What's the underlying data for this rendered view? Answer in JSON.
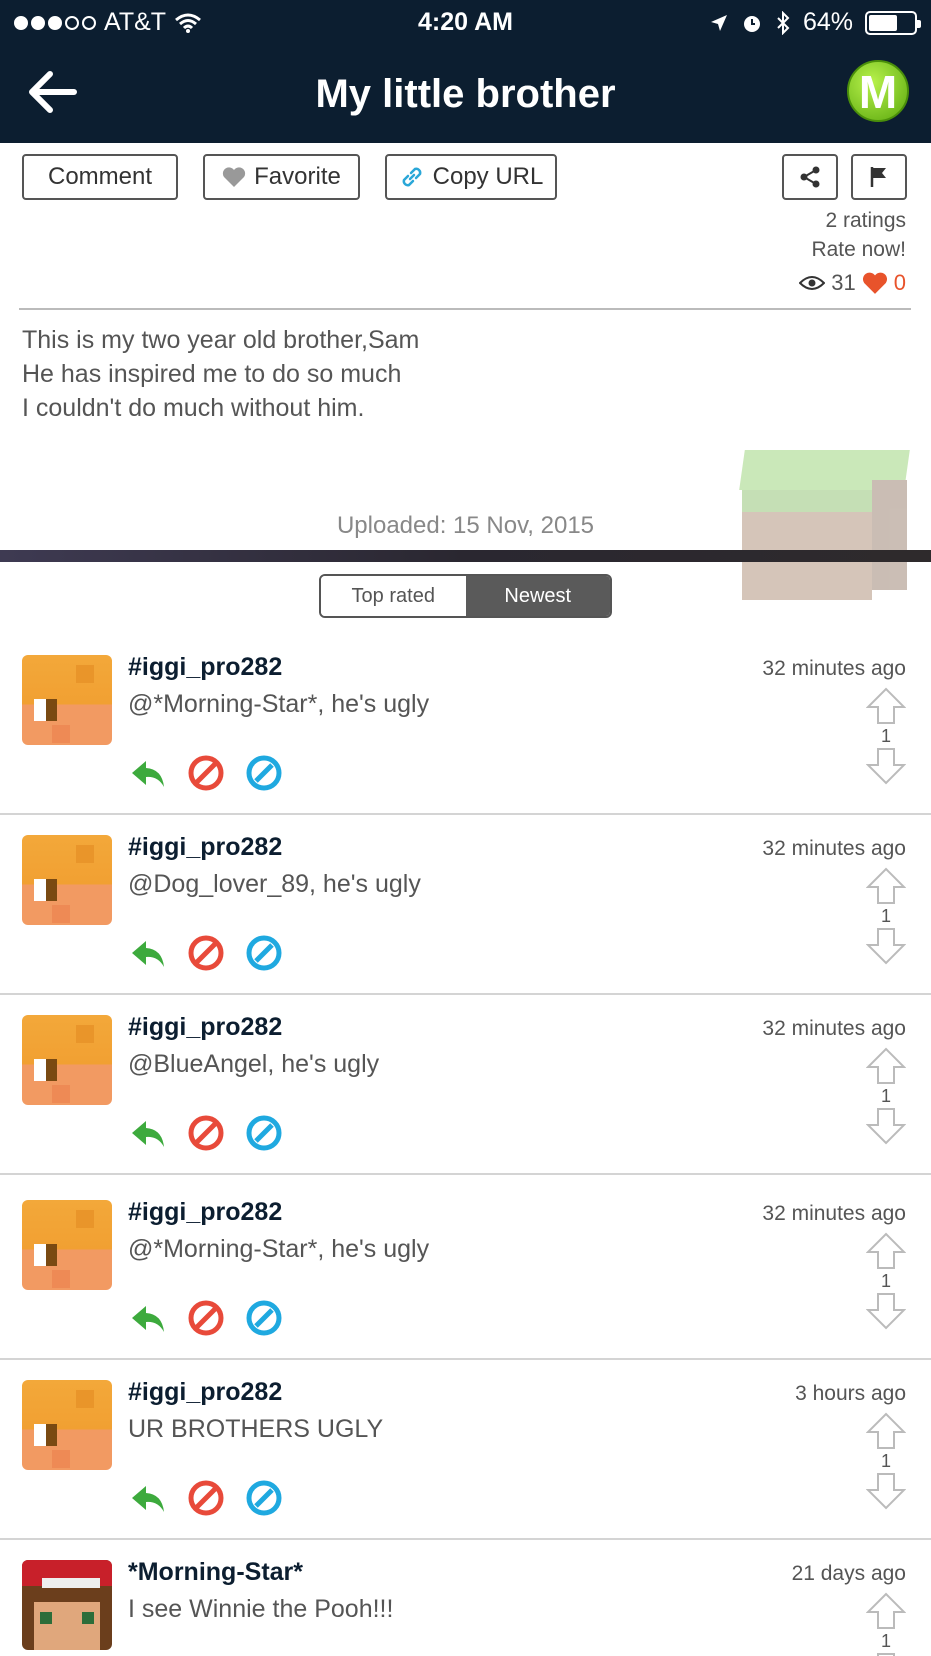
{
  "status": {
    "carrier": "AT&T",
    "time": "4:20 AM",
    "battery": "64%"
  },
  "nav": {
    "title": "My little brother",
    "logo_letter": "M"
  },
  "actions": {
    "comment": "Comment",
    "favorite": "Favorite",
    "copy_url": "Copy URL"
  },
  "meta": {
    "ratings": "2 ratings",
    "rate_now": "Rate now!",
    "views": "31",
    "likes": "0"
  },
  "description": [
    "This is my two year old brother,Sam",
    "He has inspired me to do so much",
    "I couldn't do much without him."
  ],
  "uploaded": "Uploaded: 15 Nov, 2015",
  "sort": {
    "top_rated": "Top rated",
    "newest": "Newest"
  },
  "comments": [
    {
      "user": "#iggi_pro282",
      "time": "32 minutes ago",
      "text": "@*Morning-Star*, he's ugly",
      "votes": "1"
    },
    {
      "user": "#iggi_pro282",
      "time": "32 minutes ago",
      "text": "@Dog_lover_89, he's ugly",
      "votes": "1"
    },
    {
      "user": "#iggi_pro282",
      "time": "32 minutes ago",
      "text": "@BlueAngel, he's ugly",
      "votes": "1"
    },
    {
      "user": "#iggi_pro282",
      "time": "32 minutes ago",
      "text": "@*Morning-Star*, he's ugly",
      "votes": "1"
    },
    {
      "user": "#iggi_pro282",
      "time": "3 hours ago",
      "text": "UR BROTHERS UGLY",
      "votes": "1"
    },
    {
      "user": "*Morning-Star*",
      "time": "21 days ago",
      "text": "I see Winnie the Pooh!!!",
      "votes": "1"
    }
  ]
}
